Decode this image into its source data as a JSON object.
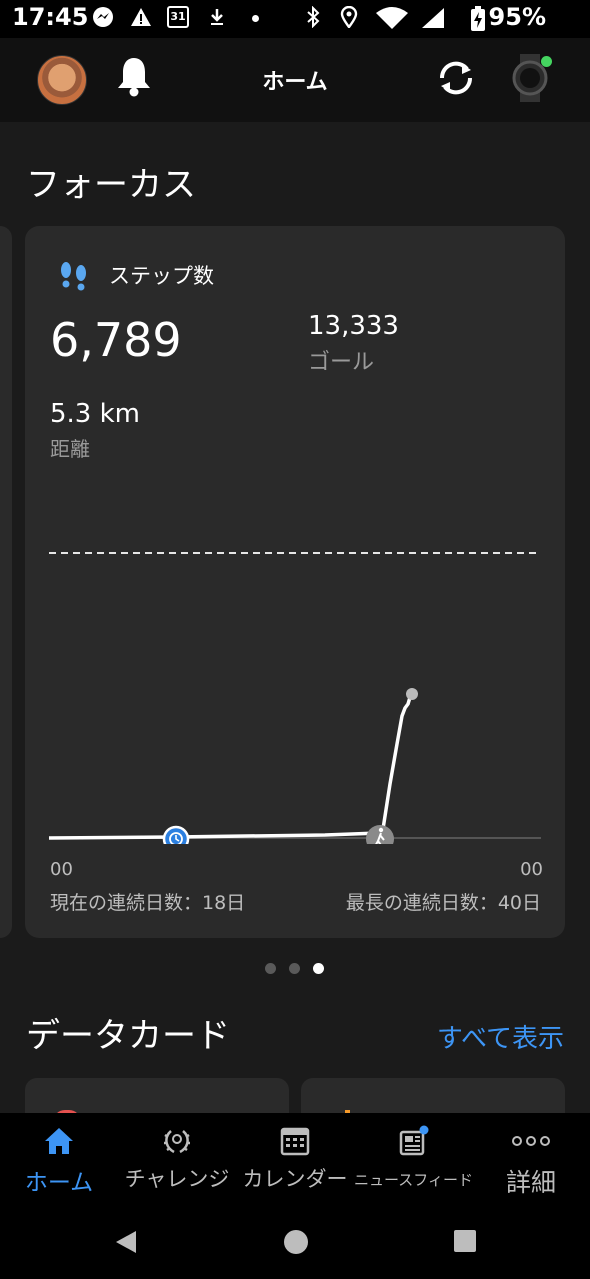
{
  "status_bar": {
    "time": "17:45",
    "calendar_day": "31",
    "battery": "95%"
  },
  "header": {
    "title": "ホーム"
  },
  "focus": {
    "section_title": "フォーカス",
    "card": {
      "label": "ステップ数",
      "steps": "6,789",
      "goal_value": "13,333",
      "goal_label": "ゴール",
      "distance_value": "5.3 km",
      "distance_label": "距離",
      "axis_start": "00",
      "axis_end": "00",
      "current_streak": "現在の連続日数：18日",
      "longest_streak": "最長の連続日数：40日"
    },
    "pager": {
      "count": 3,
      "active_index": 2
    }
  },
  "data_cards": {
    "section_title": "データカード",
    "see_all": "すべて表示"
  },
  "bottom_nav": {
    "items": [
      {
        "label": "ホーム",
        "icon": "home-icon",
        "active": true
      },
      {
        "label": "チャレンジ",
        "icon": "laurel-icon",
        "active": false
      },
      {
        "label": "カレンダー",
        "icon": "calendar-icon",
        "active": false
      },
      {
        "label": "ニュースフィード",
        "icon": "newsfeed-icon",
        "active": false
      },
      {
        "label": "詳細",
        "icon": "more-icon",
        "active": false
      }
    ]
  },
  "colors": {
    "accent": "#3d95f5",
    "background": "#1b1b1b",
    "card": "#2a2a2a",
    "online": "#45d560"
  }
}
